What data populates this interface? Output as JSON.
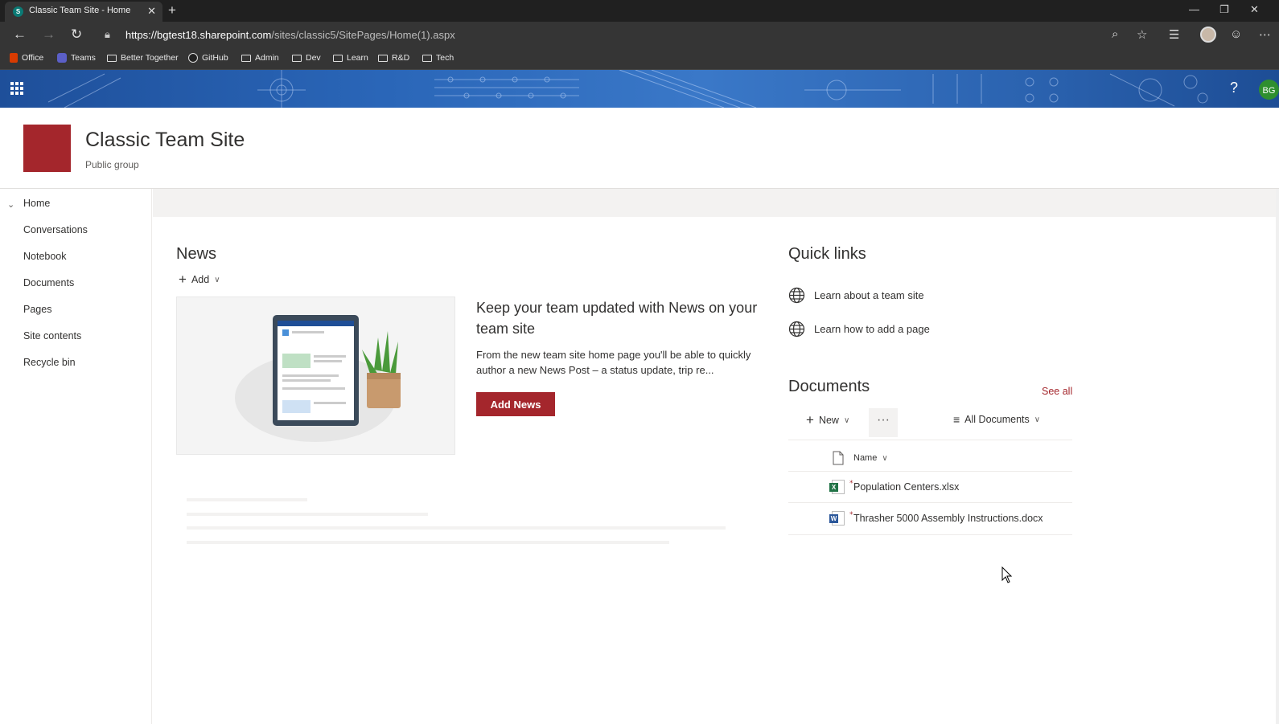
{
  "browser": {
    "tab_title": "Classic Team Site - Home",
    "tab_favicon": "S",
    "url_host": "https://bgtest18.sharepoint.com",
    "url_path": "/sites/classic5/SitePages/Home(1).aspx",
    "favorites": [
      "Office",
      "Teams",
      "Better Together",
      "GitHub",
      "Admin",
      "Dev",
      "Learn",
      "R&D",
      "Tech"
    ]
  },
  "suitebar": {
    "help": "?",
    "user_initials": "BG"
  },
  "site": {
    "title": "Classic Team Site",
    "subtitle": "Public group"
  },
  "nav": {
    "items": [
      "Home",
      "Conversations",
      "Notebook",
      "Documents",
      "Pages",
      "Site contents",
      "Recycle bin"
    ]
  },
  "news": {
    "title": "News",
    "add_label": "Add",
    "headline": "Keep your team updated with News on your team site",
    "body": "From the new team site home page you'll be able to quickly author a new News Post – a status update, trip re...",
    "button": "Add News"
  },
  "quick_links": {
    "title": "Quick links",
    "items": [
      "Learn about a team site",
      "Learn how to add a page"
    ]
  },
  "documents": {
    "title": "Documents",
    "see_all": "See all",
    "new_label": "New",
    "more": "···",
    "view_label": "All Documents",
    "name_header": "Name",
    "files": [
      {
        "name": "Population Centers.xlsx",
        "type": "excel",
        "badge": "X"
      },
      {
        "name": "Thrasher 5000 Assembly Instructions.docx",
        "type": "word",
        "badge": "W"
      }
    ]
  },
  "colors": {
    "accent": "#a4262c",
    "excel": "#217346",
    "word": "#2b579a"
  }
}
